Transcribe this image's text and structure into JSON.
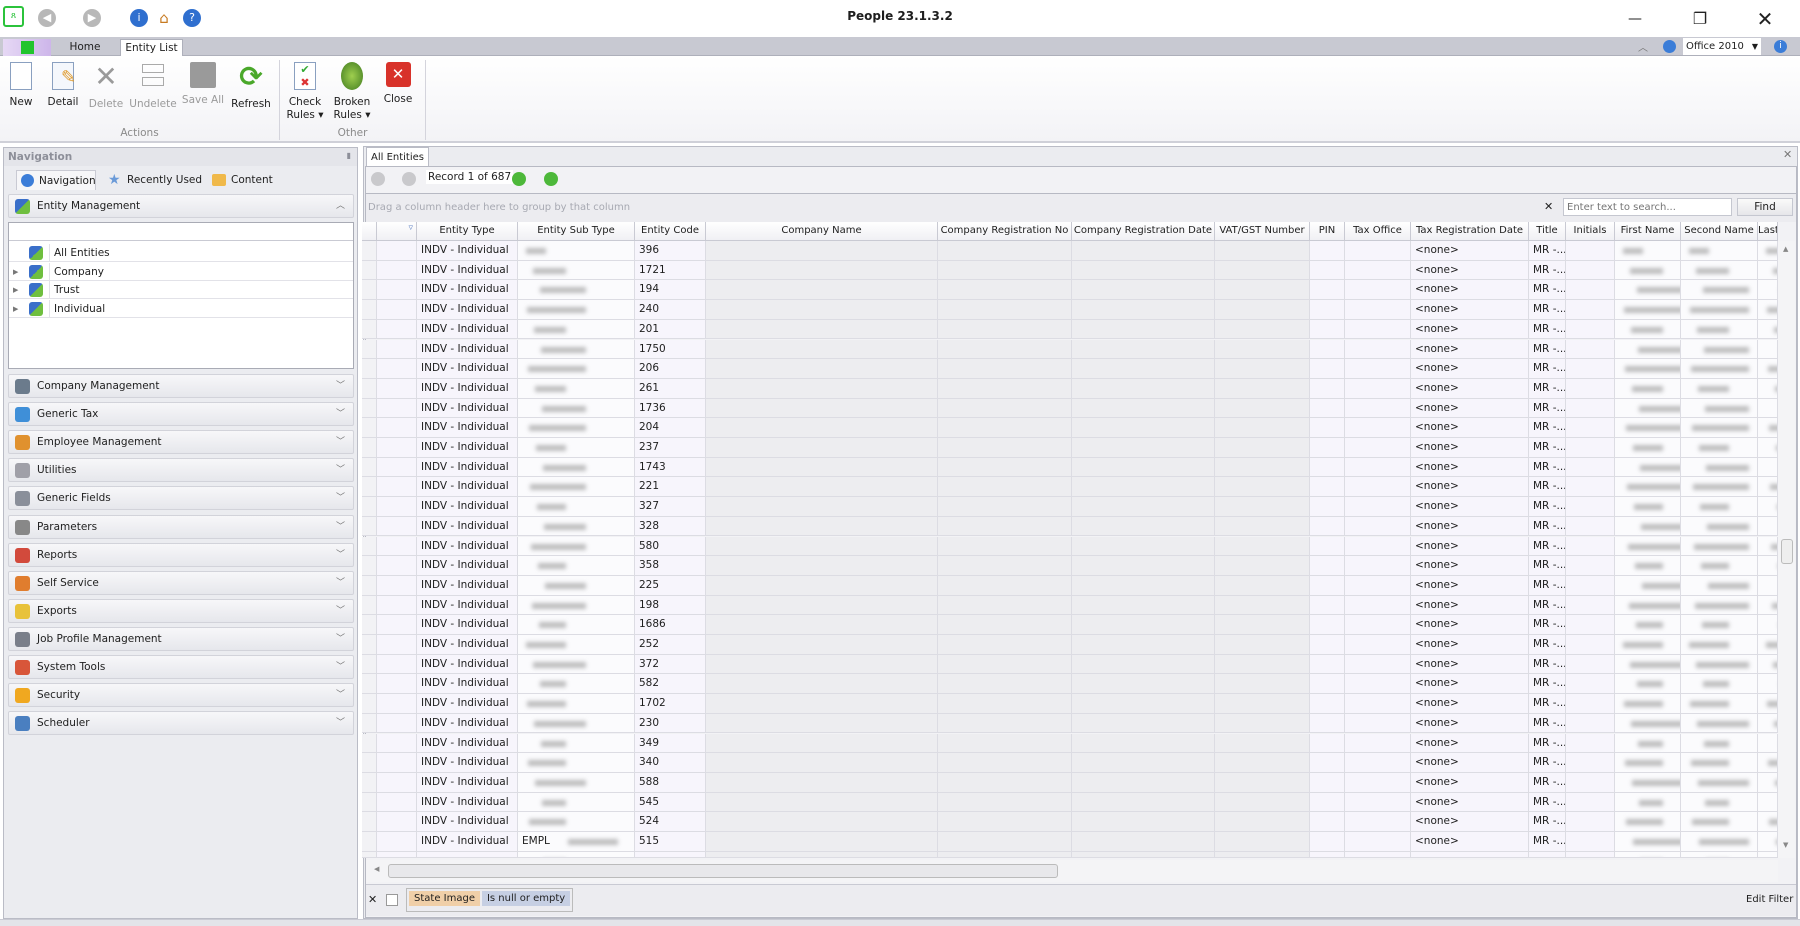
{
  "window": {
    "title": "People 23.1.3.2",
    "minimize": "—",
    "restore": "❐",
    "close": "✕"
  },
  "quick_access": {
    "back": "back-icon",
    "forward": "forward-icon",
    "info": "info-icon",
    "home": "home-icon",
    "help": "help-icon"
  },
  "ribbon": {
    "tabs": [
      {
        "label": "Home"
      },
      {
        "label": "Entity List"
      }
    ],
    "theme_select": "Office 2010",
    "groups": [
      {
        "label": "Actions"
      },
      {
        "label": "Other"
      }
    ],
    "buttons": [
      {
        "label": "New",
        "enabled": true
      },
      {
        "label": "Detail",
        "enabled": true
      },
      {
        "label": "Delete",
        "enabled": false
      },
      {
        "label": "Undelete",
        "enabled": false
      },
      {
        "label": "Save All",
        "enabled": false
      },
      {
        "label": "Refresh",
        "enabled": true
      },
      {
        "label": "Check Rules ▾",
        "enabled": true
      },
      {
        "label": "Broken Rules ▾",
        "enabled": true
      },
      {
        "label": "Close",
        "enabled": true
      }
    ]
  },
  "navigation": {
    "title": "Navigation",
    "pin": "📌",
    "tabs": [
      {
        "label": "Navigation"
      },
      {
        "label": "Recently Used"
      },
      {
        "label": "Content"
      }
    ],
    "active_group": "Entity Management",
    "tree": [
      {
        "label": "All Entities",
        "expandable": false
      },
      {
        "label": "Company",
        "expandable": true
      },
      {
        "label": "Trust",
        "expandable": true
      },
      {
        "label": "Individual",
        "expandable": true
      }
    ],
    "groups": [
      {
        "label": "Company Management",
        "color": "#6b7b8c"
      },
      {
        "label": "Generic Tax",
        "color": "#3f8fd8"
      },
      {
        "label": "Employee Management",
        "color": "#e0912e"
      },
      {
        "label": "Utilities",
        "color": "#a0a0a8"
      },
      {
        "label": "Generic Fields",
        "color": "#8a8f9a"
      },
      {
        "label": "Parameters",
        "color": "#888"
      },
      {
        "label": "Reports",
        "color": "#d24a3c"
      },
      {
        "label": "Self Service",
        "color": "#e07d2e"
      },
      {
        "label": "Exports",
        "color": "#e8c23a"
      },
      {
        "label": "Job Profile Management",
        "color": "#7a7f8a"
      },
      {
        "label": "System Tools",
        "color": "#d8563a"
      },
      {
        "label": "Security",
        "color": "#f0a820"
      },
      {
        "label": "Scheduler",
        "color": "#4a7fc0"
      }
    ]
  },
  "grid": {
    "tab": "All Entities",
    "record_nav": "Record 1 of 687",
    "group_panel_hint": "Drag a column header here to group by that column",
    "search": {
      "placeholder": "Enter text to search...",
      "find": "Find",
      "clear": "✕"
    },
    "columns": [
      "",
      "",
      "Entity Type",
      "Entity Sub Type",
      "Entity Code",
      "Company Name",
      "Company Registration No",
      "Company Registration Date",
      "VAT/GST Number",
      "PIN",
      "Tax Office",
      "Tax Registration Date",
      "Title",
      "Initials",
      "First Name",
      "Second Name",
      "Last N"
    ],
    "rows": [
      {
        "type": "INDV - Individual",
        "sub": "",
        "code": "396"
      },
      {
        "type": "INDV - Individual",
        "sub": "",
        "code": "1721"
      },
      {
        "type": "INDV - Individual",
        "sub": "",
        "code": "194"
      },
      {
        "type": "INDV - Individual",
        "sub": "",
        "code": "240"
      },
      {
        "type": "INDV - Individual",
        "sub": "",
        "code": "201"
      },
      {
        "type": "INDV - Individual",
        "sub": "",
        "code": "1750"
      },
      {
        "type": "INDV - Individual",
        "sub": "",
        "code": "206"
      },
      {
        "type": "INDV - Individual",
        "sub": "",
        "code": "261"
      },
      {
        "type": "INDV - Individual",
        "sub": "",
        "code": "1736"
      },
      {
        "type": "INDV - Individual",
        "sub": "",
        "code": "204"
      },
      {
        "type": "INDV - Individual",
        "sub": "",
        "code": "237"
      },
      {
        "type": "INDV - Individual",
        "sub": "",
        "code": "1743"
      },
      {
        "type": "INDV - Individual",
        "sub": "",
        "code": "221"
      },
      {
        "type": "INDV - Individual",
        "sub": "",
        "code": "327"
      },
      {
        "type": "INDV - Individual",
        "sub": "",
        "code": "328"
      },
      {
        "type": "INDV - Individual",
        "sub": "",
        "code": "580"
      },
      {
        "type": "INDV - Individual",
        "sub": "",
        "code": "358"
      },
      {
        "type": "INDV - Individual",
        "sub": "",
        "code": "225"
      },
      {
        "type": "INDV - Individual",
        "sub": "",
        "code": "198"
      },
      {
        "type": "INDV - Individual",
        "sub": "",
        "code": "1686"
      },
      {
        "type": "INDV - Individual",
        "sub": "",
        "code": "252"
      },
      {
        "type": "INDV - Individual",
        "sub": "",
        "code": "372"
      },
      {
        "type": "INDV - Individual",
        "sub": "",
        "code": "582"
      },
      {
        "type": "INDV - Individual",
        "sub": "",
        "code": "1702"
      },
      {
        "type": "INDV - Individual",
        "sub": "",
        "code": "230"
      },
      {
        "type": "INDV - Individual",
        "sub": "",
        "code": "349"
      },
      {
        "type": "INDV - Individual",
        "sub": "",
        "code": "340"
      },
      {
        "type": "INDV - Individual",
        "sub": "",
        "code": "588"
      },
      {
        "type": "INDV - Individual",
        "sub": "",
        "code": "545"
      },
      {
        "type": "INDV - Individual",
        "sub": "",
        "code": "524"
      },
      {
        "type": "INDV - Individual",
        "sub": "EMPL",
        "code": "515"
      }
    ],
    "tax_registration_date": "<none>",
    "title_value": "MR -...",
    "filter": {
      "clear": "✕",
      "tokens": [
        "State Image",
        "Is null or empty"
      ],
      "edit": "Edit Filter"
    }
  }
}
